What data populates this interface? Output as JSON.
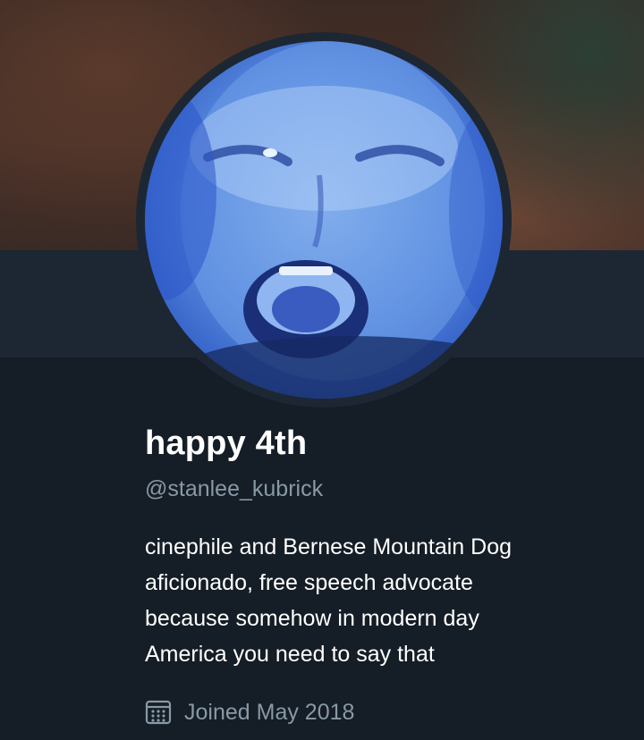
{
  "profile": {
    "display_name": "happy 4th",
    "handle": "@stanlee_kubrick",
    "bio": "cinephile and Bernese Mountain Dog\naficionado, free speech advocate\nbecause somehow in modern day\nAmerica you need to say that",
    "joined": "Joined May 2018"
  },
  "icons": {
    "joined": "calendar-icon"
  },
  "colors": {
    "background": "#151d26",
    "profile_bar": "#1c2733",
    "name_text": "#ffffff",
    "secondary_text": "#8899a6",
    "avatar_blue": "#5b8de0"
  }
}
